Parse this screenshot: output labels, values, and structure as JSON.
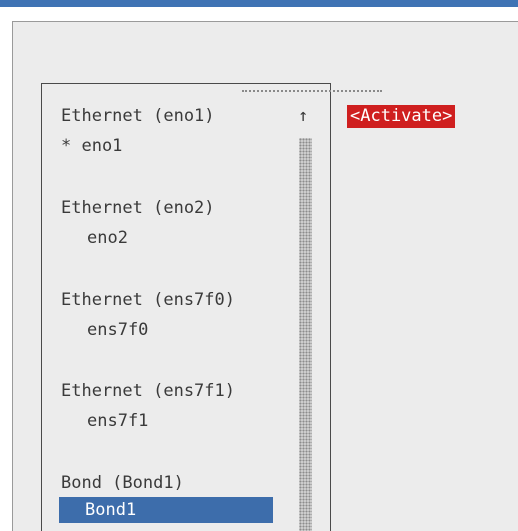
{
  "connections": [
    {
      "type_label": "Ethernet (eno1)",
      "device_label": "* eno1"
    },
    {
      "type_label": "Ethernet (eno2)",
      "device_label": "eno2"
    },
    {
      "type_label": "Ethernet (ens7f0)",
      "device_label": "ens7f0"
    },
    {
      "type_label": "Ethernet (ens7f1)",
      "device_label": "ens7f1"
    },
    {
      "type_label": "Bond (Bond1)",
      "device_label": "Bond1"
    }
  ],
  "scrollbar": {
    "arrow": "↑"
  },
  "actions": {
    "activate_label": "<Activate>"
  },
  "colors": {
    "accent": "#3d6dab",
    "activate": "#cf1f1f",
    "background": "#ececec"
  }
}
